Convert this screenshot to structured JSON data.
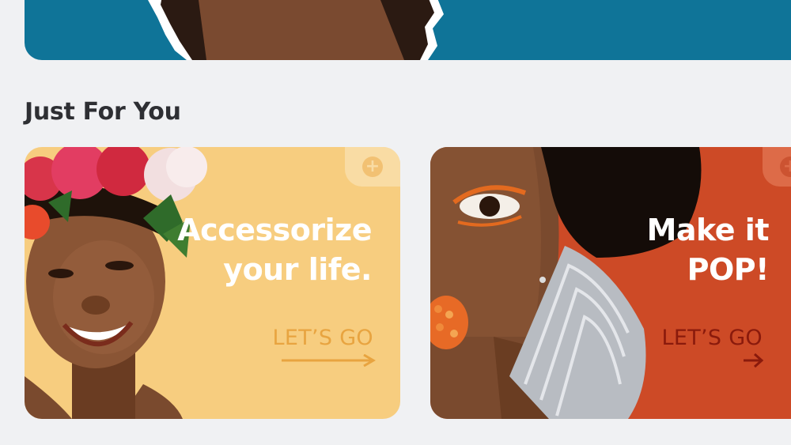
{
  "section": {
    "title": "Just For You"
  },
  "cards": [
    {
      "headline_line1": "Accessorize",
      "headline_line2": "your life.",
      "cta_label": "LET’S GO",
      "add_symbol": "+",
      "background_color": "#f7cd7f",
      "image": "smiling woman wearing a flower crown"
    },
    {
      "headline_line1": "Make it",
      "headline_line2": "POP!",
      "cta_label": "LET’S GO",
      "add_symbol": "+",
      "background_color": "#cd4a26",
      "image": "woman with orange eye makeup and silver fan earring"
    }
  ],
  "hero": {
    "background_color": "#0f7498",
    "image": "torn paper reveal portrait"
  },
  "colors": {
    "page_background": "#f0f1f3",
    "title_text": "#2e2f33",
    "cta_yellow": "#e8a440",
    "cta_red": "#8a1a0c"
  }
}
